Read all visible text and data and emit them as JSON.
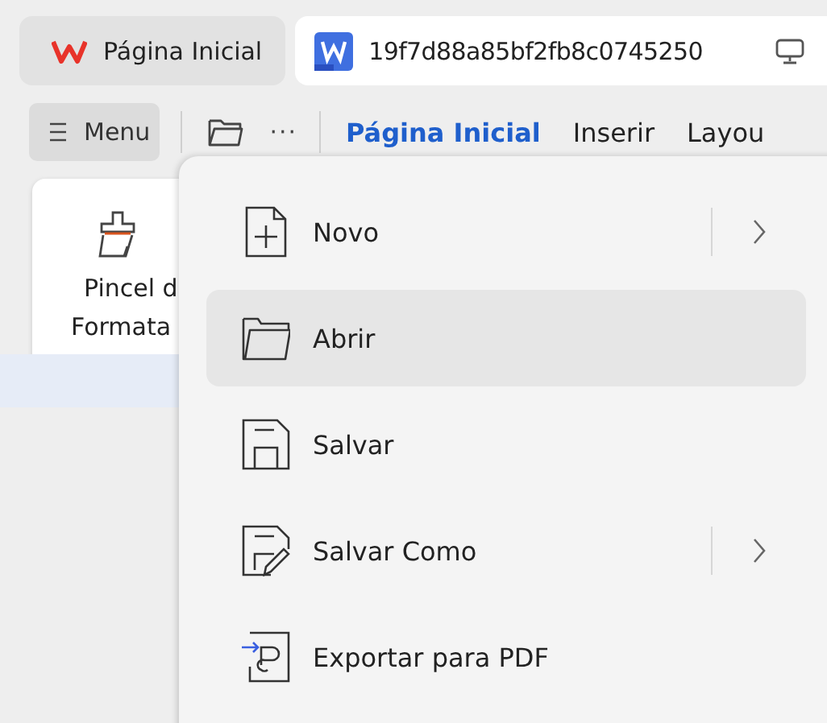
{
  "tabs": [
    {
      "label": "Página Inicial",
      "selected": false,
      "kind": "app"
    },
    {
      "label": "19f7d88a85bf2fb8c0745250",
      "selected": true,
      "kind": "document"
    }
  ],
  "toolbar": {
    "menu_label": "Menu",
    "more": "···"
  },
  "ribbon_tabs": [
    {
      "label": "Página Inicial",
      "selected": true
    },
    {
      "label": "Inserir",
      "selected": false
    },
    {
      "label": "Layou",
      "selected": false
    }
  ],
  "ribbon_tool": {
    "lines": [
      "Pincel d",
      "Formata"
    ]
  },
  "menu": {
    "items": [
      {
        "label": "Novo",
        "kind": "new",
        "submenu": true,
        "selected": false
      },
      {
        "label": "Abrir",
        "kind": "open",
        "submenu": false,
        "selected": true
      },
      {
        "label": "Salvar",
        "kind": "save",
        "submenu": false,
        "selected": false
      },
      {
        "label": "Salvar Como",
        "kind": "saveas",
        "submenu": true,
        "selected": false
      },
      {
        "label": "Exportar para PDF",
        "kind": "export",
        "submenu": false,
        "selected": false
      }
    ]
  }
}
